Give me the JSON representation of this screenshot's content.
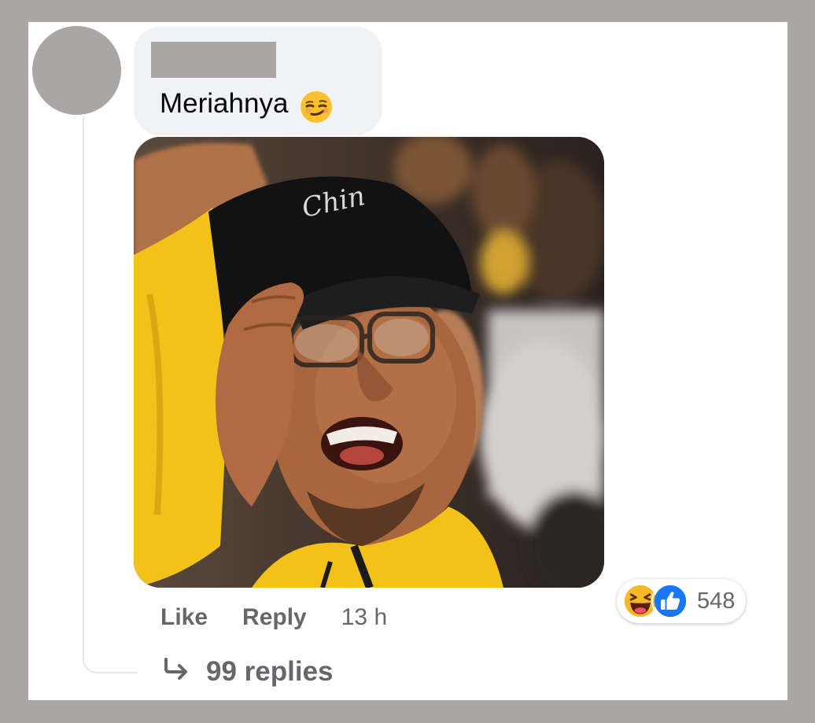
{
  "comment": {
    "author_name": "",
    "text": "Meriahnya",
    "emoji": "smirking-face-emoji",
    "photo": "crowd-fan-yellow-shirt-black-cap-photo"
  },
  "actions": {
    "like_label": "Like",
    "reply_label": "Reply",
    "timestamp": "13 h"
  },
  "reactions": {
    "icons": [
      "laughing-face-icon",
      "thumbs-up-icon"
    ],
    "count": "548"
  },
  "replies": {
    "label": "99 replies",
    "icon": "reply-arrow-icon"
  },
  "colors": {
    "background": "#aaa6a6",
    "bubble": "#f0f2f5",
    "secondary_text": "#65676b",
    "like_blue": "#1877f2"
  }
}
